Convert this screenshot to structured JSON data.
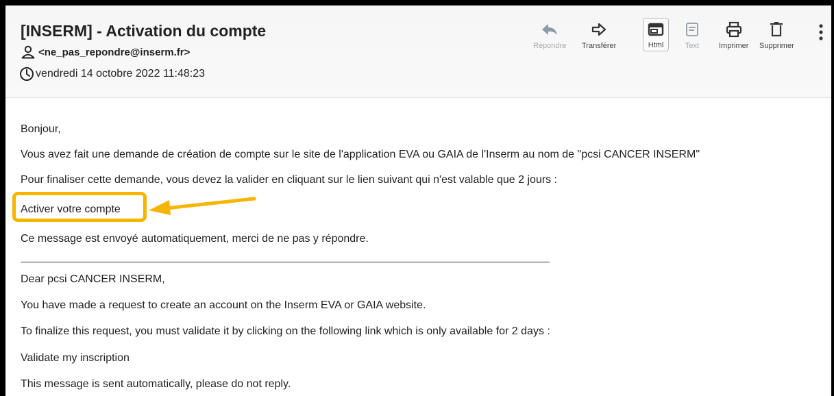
{
  "email": {
    "subject": "[INSERM] - Activation du compte",
    "sender": "<ne_pas_repondre@inserm.fr>",
    "date": "vendredi 14 octobre 2022 11:48:23"
  },
  "toolbar": {
    "reply": "Répondre",
    "forward": "Transférer",
    "html": "Html",
    "text": "Text",
    "print": "Imprimer",
    "delete": "Supprimer"
  },
  "body": {
    "greeting_fr": "Bonjour,",
    "line1_fr": "Vous avez fait une demande de création de compte sur le site de l'application EVA ou GAIA de l'Inserm au nom de \"pcsi CANCER INSERM\"",
    "line2_fr": "Pour finaliser cette demande, vous devez la valider en cliquant sur le lien suivant qui n'est valable que 2 jours :",
    "link_fr": "Activer votre compte",
    "auto_fr": "Ce message est envoyé automatiquement, merci de ne pas y répondre.",
    "greeting_en": "Dear pcsi CANCER INSERM,",
    "line1_en": "You have made a request to create an account on the Inserm EVA or GAIA website.",
    "line2_en": "To finalize this request, you must validate it by clicking on the following link which is only available for 2 days :",
    "link_en": "Validate my inscription",
    "auto_en": "This message is sent automatically, please do not reply."
  },
  "colors": {
    "highlight": "#f7b500",
    "text": "#222222",
    "header_bg": "#f6f6f6"
  },
  "icons": {
    "sender": "user-icon",
    "date": "clock-icon",
    "reply": "reply-arrow-icon",
    "forward": "forward-arrow-icon",
    "html": "html-view-icon",
    "text": "text-view-icon",
    "print": "printer-icon",
    "delete": "trash-icon",
    "more": "more-vertical-icon",
    "annotation": "annotation-arrow-icon"
  }
}
